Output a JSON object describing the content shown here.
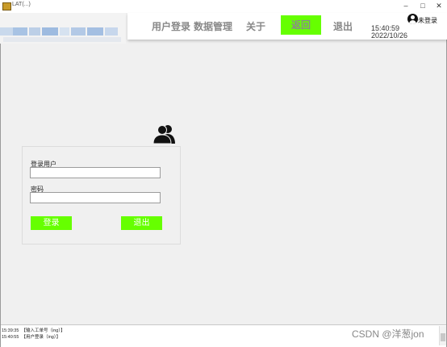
{
  "window": {
    "title": "LAT(...)",
    "controls": [
      "–",
      "□",
      "✕"
    ]
  },
  "nav": {
    "items": [
      "用户登录",
      "数据管理",
      "关于"
    ],
    "active": "返回",
    "exit": "退出"
  },
  "clock": {
    "time": "15:40:59",
    "date": "2022/10/26"
  },
  "user": {
    "status": "未登录",
    "icon": "user-circle-icon"
  },
  "login": {
    "icon": "users-group-icon",
    "username_label": "登录用户",
    "password_label": "密码",
    "username_value": "",
    "password_value": "",
    "login_button": "登录",
    "exit_button": "退出"
  },
  "log": [
    {
      "time": "15:39:35",
      "message": "【输入工单号（ing）】"
    },
    {
      "time": "15:40:55",
      "message": "【用户登录（ing）】"
    }
  ],
  "watermark": "CSDN @洋葱jon",
  "colors": {
    "accent": "#66ff00",
    "background": "#f0f0f0",
    "toolbar": "#ffffff"
  }
}
